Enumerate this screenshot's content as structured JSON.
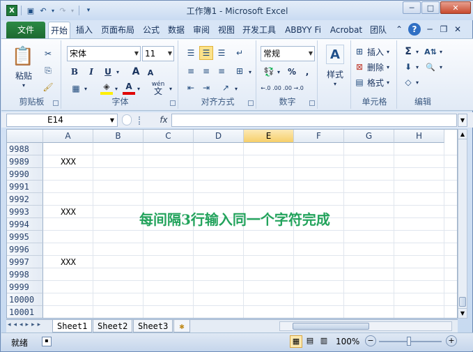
{
  "window": {
    "title": "工作簿1 - Microsoft Excel"
  },
  "qat": {
    "app_icon": "X"
  },
  "tabs": [
    "开始",
    "插入",
    "页面布局",
    "公式",
    "数据",
    "审阅",
    "视图",
    "开发工具",
    "ABBYY Fi",
    "Acrobat",
    "团队"
  ],
  "file_tab": "文件",
  "ribbon": {
    "clipboard": {
      "label": "剪贴板",
      "paste": "粘贴"
    },
    "font": {
      "label": "字体",
      "name": "宋体",
      "size": "11",
      "bold": "B",
      "italic": "I",
      "underline": "U",
      "grow": "A",
      "shrink": "A",
      "phonetic": "wén"
    },
    "alignment": {
      "label": "对齐方式"
    },
    "number": {
      "label": "数字",
      "format": "常规",
      "percent": "%",
      "comma": ",",
      "inc": "←.0 .00",
      "dec": ".00 →.0"
    },
    "styles": {
      "label": "样式"
    },
    "cells": {
      "label": "单元格",
      "insert": "插入",
      "delete": "删除",
      "format": "格式"
    },
    "editing": {
      "label": "编辑",
      "sum": "Σ"
    }
  },
  "formula_bar": {
    "name_box": "E14",
    "fx": "fx",
    "value": ""
  },
  "grid": {
    "columns": [
      "A",
      "B",
      "C",
      "D",
      "E",
      "F",
      "G",
      "H"
    ],
    "selected_column": "E",
    "rows": [
      {
        "num": "9988",
        "a": ""
      },
      {
        "num": "9989",
        "a": "XXX"
      },
      {
        "num": "9990",
        "a": ""
      },
      {
        "num": "9991",
        "a": ""
      },
      {
        "num": "9992",
        "a": ""
      },
      {
        "num": "9993",
        "a": "XXX"
      },
      {
        "num": "9994",
        "a": ""
      },
      {
        "num": "9995",
        "a": ""
      },
      {
        "num": "9996",
        "a": ""
      },
      {
        "num": "9997",
        "a": "XXX"
      },
      {
        "num": "9998",
        "a": ""
      },
      {
        "num": "9999",
        "a": ""
      },
      {
        "num": "10000",
        "a": ""
      },
      {
        "num": "10001",
        "a": ""
      }
    ],
    "overlay_text": "每间隔3行输入同一个字符完成"
  },
  "sheets": [
    "Sheet1",
    "Sheet2",
    "Sheet3"
  ],
  "status": {
    "ready": "就绪",
    "zoom": "100%"
  }
}
